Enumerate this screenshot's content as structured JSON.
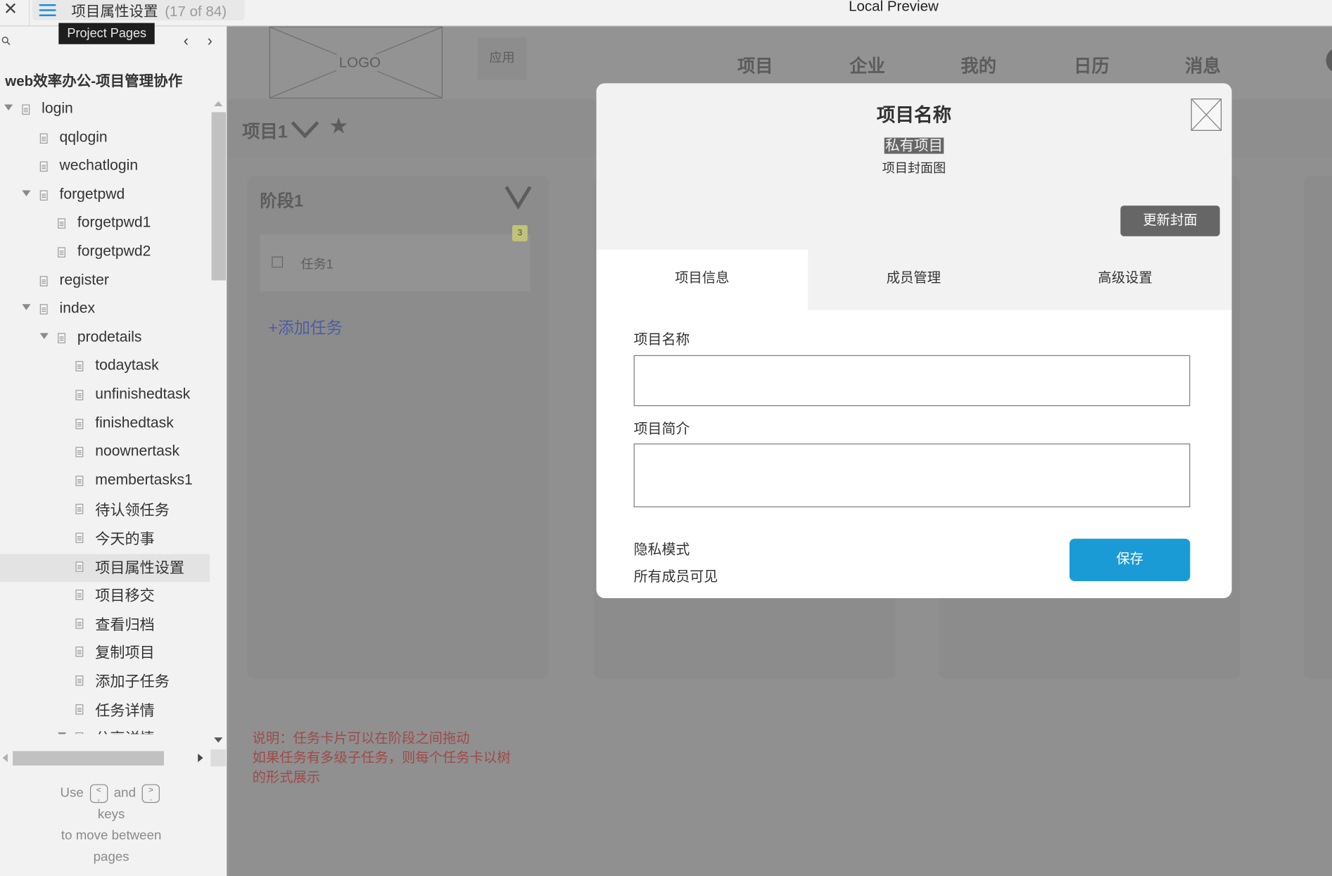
{
  "window": {
    "close_icon": "✕",
    "current_page": "项目属性设置",
    "page_position": "(17 of 84)",
    "preview_title": "Local Preview"
  },
  "sidebar": {
    "tooltip": "Project Pages",
    "prev_icon": "‹",
    "next_icon": "›",
    "project_name": "web效率办公-项目管理协作",
    "tree": [
      {
        "label": "login",
        "level": 0,
        "expanded": true
      },
      {
        "label": "qqlogin",
        "level": 1
      },
      {
        "label": "wechatlogin",
        "level": 1
      },
      {
        "label": "forgetpwd",
        "level": 1,
        "expanded": true
      },
      {
        "label": "forgetpwd1",
        "level": 2
      },
      {
        "label": "forgetpwd2",
        "level": 2
      },
      {
        "label": "register",
        "level": 1
      },
      {
        "label": "index",
        "level": 1,
        "expanded": true
      },
      {
        "label": "prodetails",
        "level": 2,
        "expanded": true
      },
      {
        "label": "todaytask",
        "level": 3
      },
      {
        "label": "unfinishedtask",
        "level": 3
      },
      {
        "label": "finishedtask",
        "level": 3
      },
      {
        "label": "noownertask",
        "level": 3
      },
      {
        "label": "membertasks1",
        "level": 3
      },
      {
        "label": "待认领任务",
        "level": 3
      },
      {
        "label": "今天的事",
        "level": 3
      },
      {
        "label": "项目属性设置",
        "level": 3,
        "selected": true
      },
      {
        "label": "项目移交",
        "level": 3
      },
      {
        "label": "查看归档",
        "level": 3
      },
      {
        "label": "复制项目",
        "level": 3
      },
      {
        "label": "添加子任务",
        "level": 3
      },
      {
        "label": "任务详情",
        "level": 3
      },
      {
        "label": "分享详情",
        "level": 3,
        "expanded": true
      }
    ],
    "hint": {
      "use": "Use",
      "key_prev_top": "<",
      "key_prev_bottom": ",",
      "and": "and",
      "key_next_top": ">",
      "key_next_bottom": ".",
      "line2": "keys",
      "line3": "to move between",
      "line4": "pages"
    }
  },
  "preview": {
    "logo_text": "LOGO",
    "apps_label": "应用",
    "nav": [
      "项目",
      "企业",
      "我的",
      "日历",
      "消息"
    ],
    "project_title": "项目1",
    "star_icon": "★",
    "stage": {
      "title": "阶段1",
      "task": "任务1",
      "badge": "3",
      "add_task": "+添加任务"
    },
    "note_lines": [
      "说明：任务卡片可以在阶段之间拖动",
      "如果任务有多级子任务，则每个任务卡以树",
      "的形式展示"
    ]
  },
  "modal": {
    "title": "项目名称",
    "privacy_tag": "私有项目",
    "cover_label": "项目封面图",
    "update_cover_button": "更新封面",
    "tabs": [
      "项目信息",
      "成员管理",
      "高级设置"
    ],
    "active_tab": 0,
    "fields": {
      "name_label": "项目名称",
      "name_value": "",
      "desc_label": "项目简介",
      "desc_value": ""
    },
    "privacy_label": "隐私模式",
    "privacy_value": "所有成员可见",
    "save_button": "保存"
  },
  "colors": {
    "accent": "#1a9bd6",
    "overlay": "#909090",
    "note_text": "#9e4a4a",
    "badge": "#c2c27a",
    "link": "#4c5ea0"
  }
}
